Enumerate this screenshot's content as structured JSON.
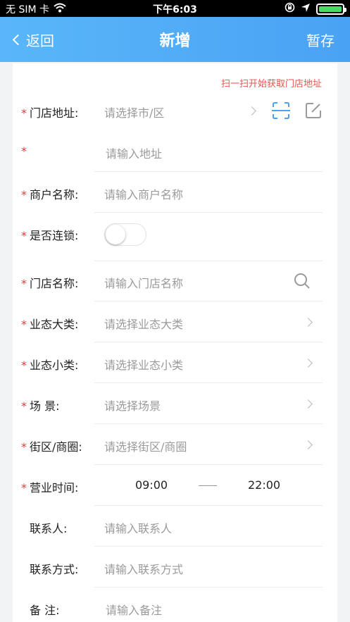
{
  "status_bar": {
    "carrier": "无 SIM 卡",
    "time": "下午6:03",
    "battery_level": 1.0
  },
  "nav": {
    "back_label": "返回",
    "title": "新增",
    "action_label": "暂存"
  },
  "form": {
    "scan_tip": "扫一扫开始获取门店地址",
    "store_address": {
      "required": "*",
      "label": "门店地址:",
      "placeholder": "请选择市/区"
    },
    "address_detail": {
      "required": "*",
      "placeholder": "请输入地址"
    },
    "merchant_name": {
      "required": "*",
      "label": "商户名称:",
      "placeholder": "请输入商户名称"
    },
    "is_chain": {
      "required": "*",
      "label": "是否连锁:",
      "value": false
    },
    "store_name": {
      "required": "*",
      "label": "门店名称:",
      "placeholder": "请输入门店名称"
    },
    "business_category": {
      "required": "*",
      "label": "业态大类:",
      "placeholder": "请选择业态大类"
    },
    "business_subcategory": {
      "required": "*",
      "label": "业态小类:",
      "placeholder": "请选择业态小类"
    },
    "scene": {
      "required": "*",
      "label": "场 景:",
      "placeholder": "请选择场景"
    },
    "district": {
      "required": "*",
      "label": "街区/商圈:",
      "placeholder": "请选择街区/商圈"
    },
    "business_hours": {
      "required": "*",
      "label": "营业时间:",
      "start": "09:00",
      "end": "22:00"
    },
    "contact_person": {
      "label": "联系人:",
      "placeholder": "请输入联系人"
    },
    "contact_method": {
      "label": "联系方式:",
      "placeholder": "请输入联系方式"
    },
    "remarks": {
      "label": "备 注:",
      "placeholder": "请输入备注"
    }
  },
  "colors": {
    "nav_gradient_start": "#5ab6f9",
    "nav_gradient_end": "#4aa2f4",
    "required_mark": "#e23b3b",
    "scan_tip": "#e7534f",
    "scan_icon": "#4aa2f4"
  }
}
